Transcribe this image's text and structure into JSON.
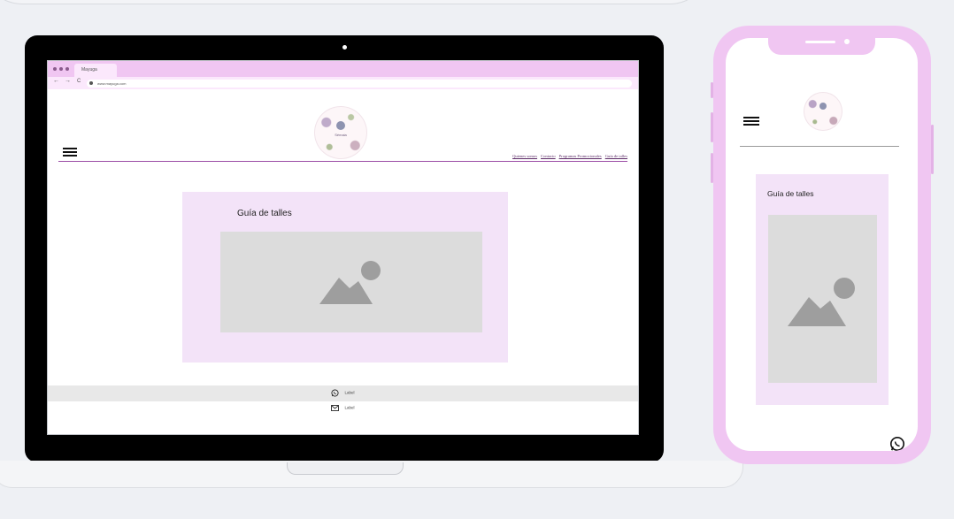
{
  "laptop": {
    "browser": {
      "tab_title": "Mayuga",
      "nav_back": "←",
      "nav_forward": "→",
      "nav_reload": "C",
      "url": "www.mayuga.com"
    },
    "site": {
      "logo_text": "Sémaia",
      "nav_links": [
        "Quienes somos",
        "Contacto",
        "Programas Promocionales",
        "Guía de talles"
      ],
      "card_title": "Guía de talles",
      "footer": {
        "whatsapp_label": "Label",
        "email_label": "Label"
      }
    }
  },
  "phone": {
    "card_title": "Guía de talles"
  },
  "colors": {
    "accent_pink": "#f0c6f2",
    "card_bg": "#f3e3f8",
    "nav_text": "#5c2b67",
    "placeholder": "#dcdcdc"
  },
  "icons": [
    "menu-icon",
    "image-placeholder-icon",
    "whatsapp-icon",
    "mail-icon",
    "lock-icon"
  ]
}
